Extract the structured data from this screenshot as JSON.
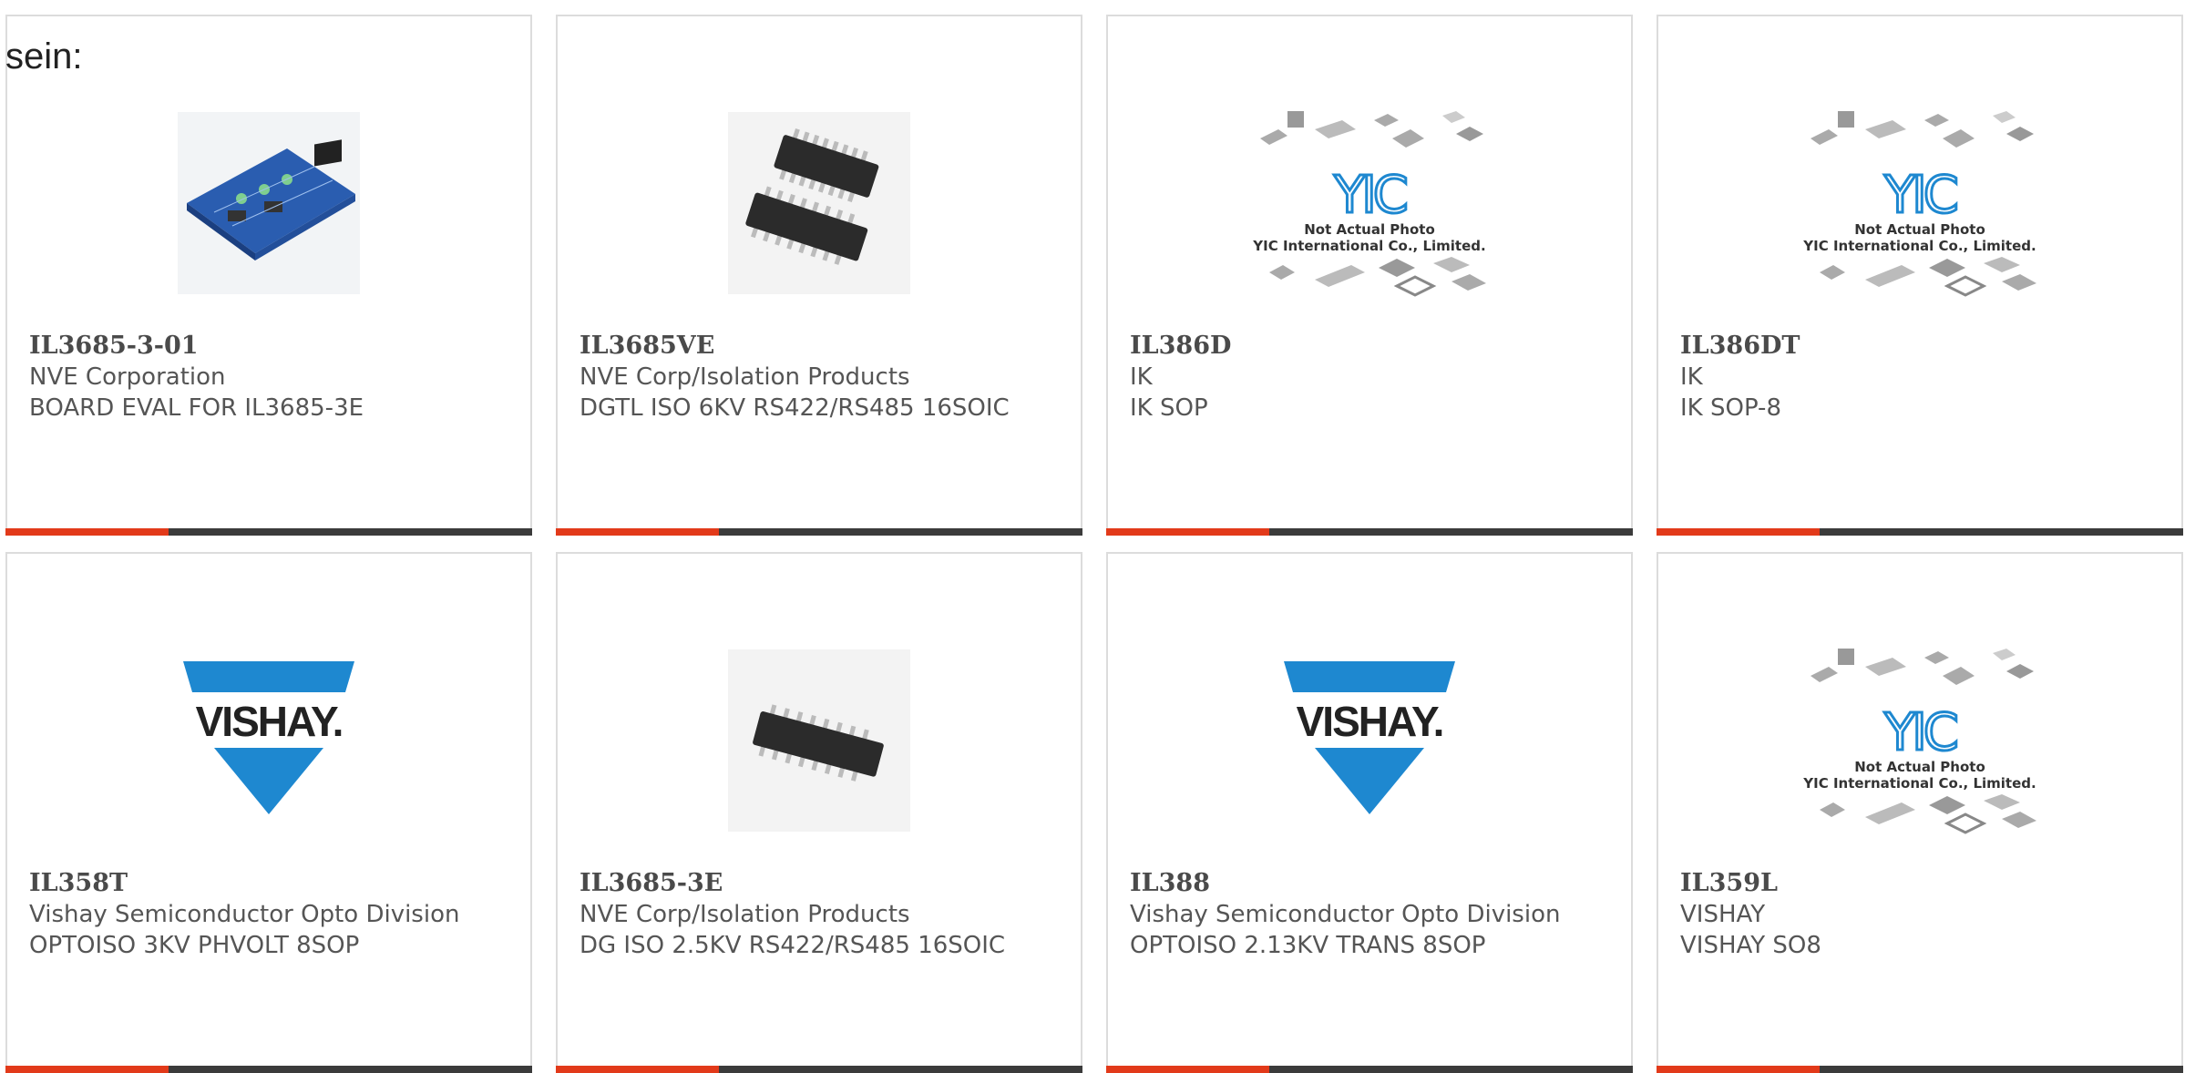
{
  "intro": "sein:",
  "colors": {
    "accent": "#e23a1a",
    "bar": "#3b3b3b",
    "vishay_blue": "#1e88d0",
    "text": "#555555"
  },
  "yic_caption": {
    "line1": "Not Actual Photo",
    "line2": "YIC International Co., Limited."
  },
  "vishay_wordmark": "VISHAY.",
  "products": [
    {
      "part": "IL3685-3-01",
      "manufacturer": "NVE Corporation",
      "description": "BOARD EVAL FOR IL3685-3E",
      "image": "evaluation-board-photo",
      "accent_fraction": 0.31
    },
    {
      "part": "IL3685VE",
      "manufacturer": "NVE Corp/Isolation Products",
      "description": "DGTL ISO 6KV RS422/RS485 16SOIC",
      "image": "ic-chip-photo",
      "accent_fraction": 0.31
    },
    {
      "part": "IL386D",
      "manufacturer": "IK",
      "description": "IK SOP",
      "image": "yic-placeholder",
      "accent_fraction": 0.31
    },
    {
      "part": "IL386DT",
      "manufacturer": "IK",
      "description": "IK SOP-8",
      "image": "yic-placeholder",
      "accent_fraction": 0.31
    },
    {
      "part": "IL358T",
      "manufacturer": "Vishay Semiconductor Opto Division",
      "description": "OPTOISO 3KV PHVOLT 8SOP",
      "image": "vishay-logo",
      "accent_fraction": 0.31
    },
    {
      "part": "IL3685-3E",
      "manufacturer": "NVE Corp/Isolation Products",
      "description": "DG ISO 2.5KV RS422/RS485 16SOIC",
      "image": "ic-chip-photo",
      "accent_fraction": 0.31
    },
    {
      "part": "IL388",
      "manufacturer": "Vishay Semiconductor Opto Division",
      "description": "OPTOISO 2.13KV TRANS 8SOP",
      "image": "vishay-logo",
      "accent_fraction": 0.31
    },
    {
      "part": "IL359L",
      "manufacturer": "VISHAY",
      "description": "VISHAY SO8",
      "image": "yic-placeholder",
      "accent_fraction": 0.31
    }
  ]
}
